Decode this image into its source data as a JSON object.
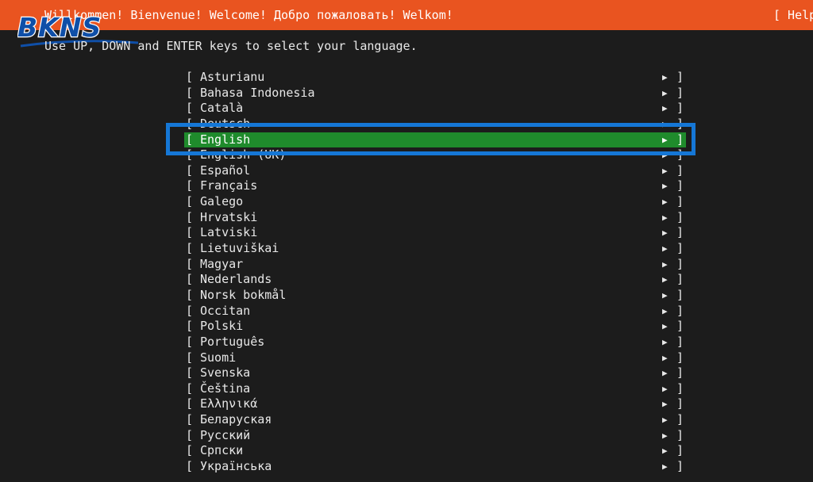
{
  "header": {
    "title": "Willkommen! Bienvenue! Welcome! Добро пожаловать! Welkom!",
    "help": "[ Help ]"
  },
  "logo": {
    "text": "BKNS",
    "color": "#0f4fa8"
  },
  "instructions": "Use UP, DOWN and ENTER keys to select your language.",
  "languages": [
    {
      "label": "Asturianu"
    },
    {
      "label": "Bahasa Indonesia"
    },
    {
      "label": "Català"
    },
    {
      "label": "Deutsch"
    },
    {
      "label": "English",
      "selected": true
    },
    {
      "label": "English (UK)"
    },
    {
      "label": "Español"
    },
    {
      "label": "Français"
    },
    {
      "label": "Galego"
    },
    {
      "label": "Hrvatski"
    },
    {
      "label": "Latviski"
    },
    {
      "label": "Lietuviškai"
    },
    {
      "label": "Magyar"
    },
    {
      "label": "Nederlands"
    },
    {
      "label": "Norsk bokmål"
    },
    {
      "label": "Occitan"
    },
    {
      "label": "Polski"
    },
    {
      "label": "Português"
    },
    {
      "label": "Suomi"
    },
    {
      "label": "Svenska"
    },
    {
      "label": "Čeština"
    },
    {
      "label": "Ελληνικά"
    },
    {
      "label": "Беларуская"
    },
    {
      "label": "Русский"
    },
    {
      "label": "Српски"
    },
    {
      "label": "Українська"
    }
  ],
  "list_glyphs": {
    "bracket_open": "[",
    "bracket_close": "]",
    "arrow": "▶"
  },
  "colors": {
    "header_bg": "#e95420",
    "selected_bg": "#1f8b2c",
    "highlight_border": "#1577d6",
    "background": "#1c1c1c"
  }
}
